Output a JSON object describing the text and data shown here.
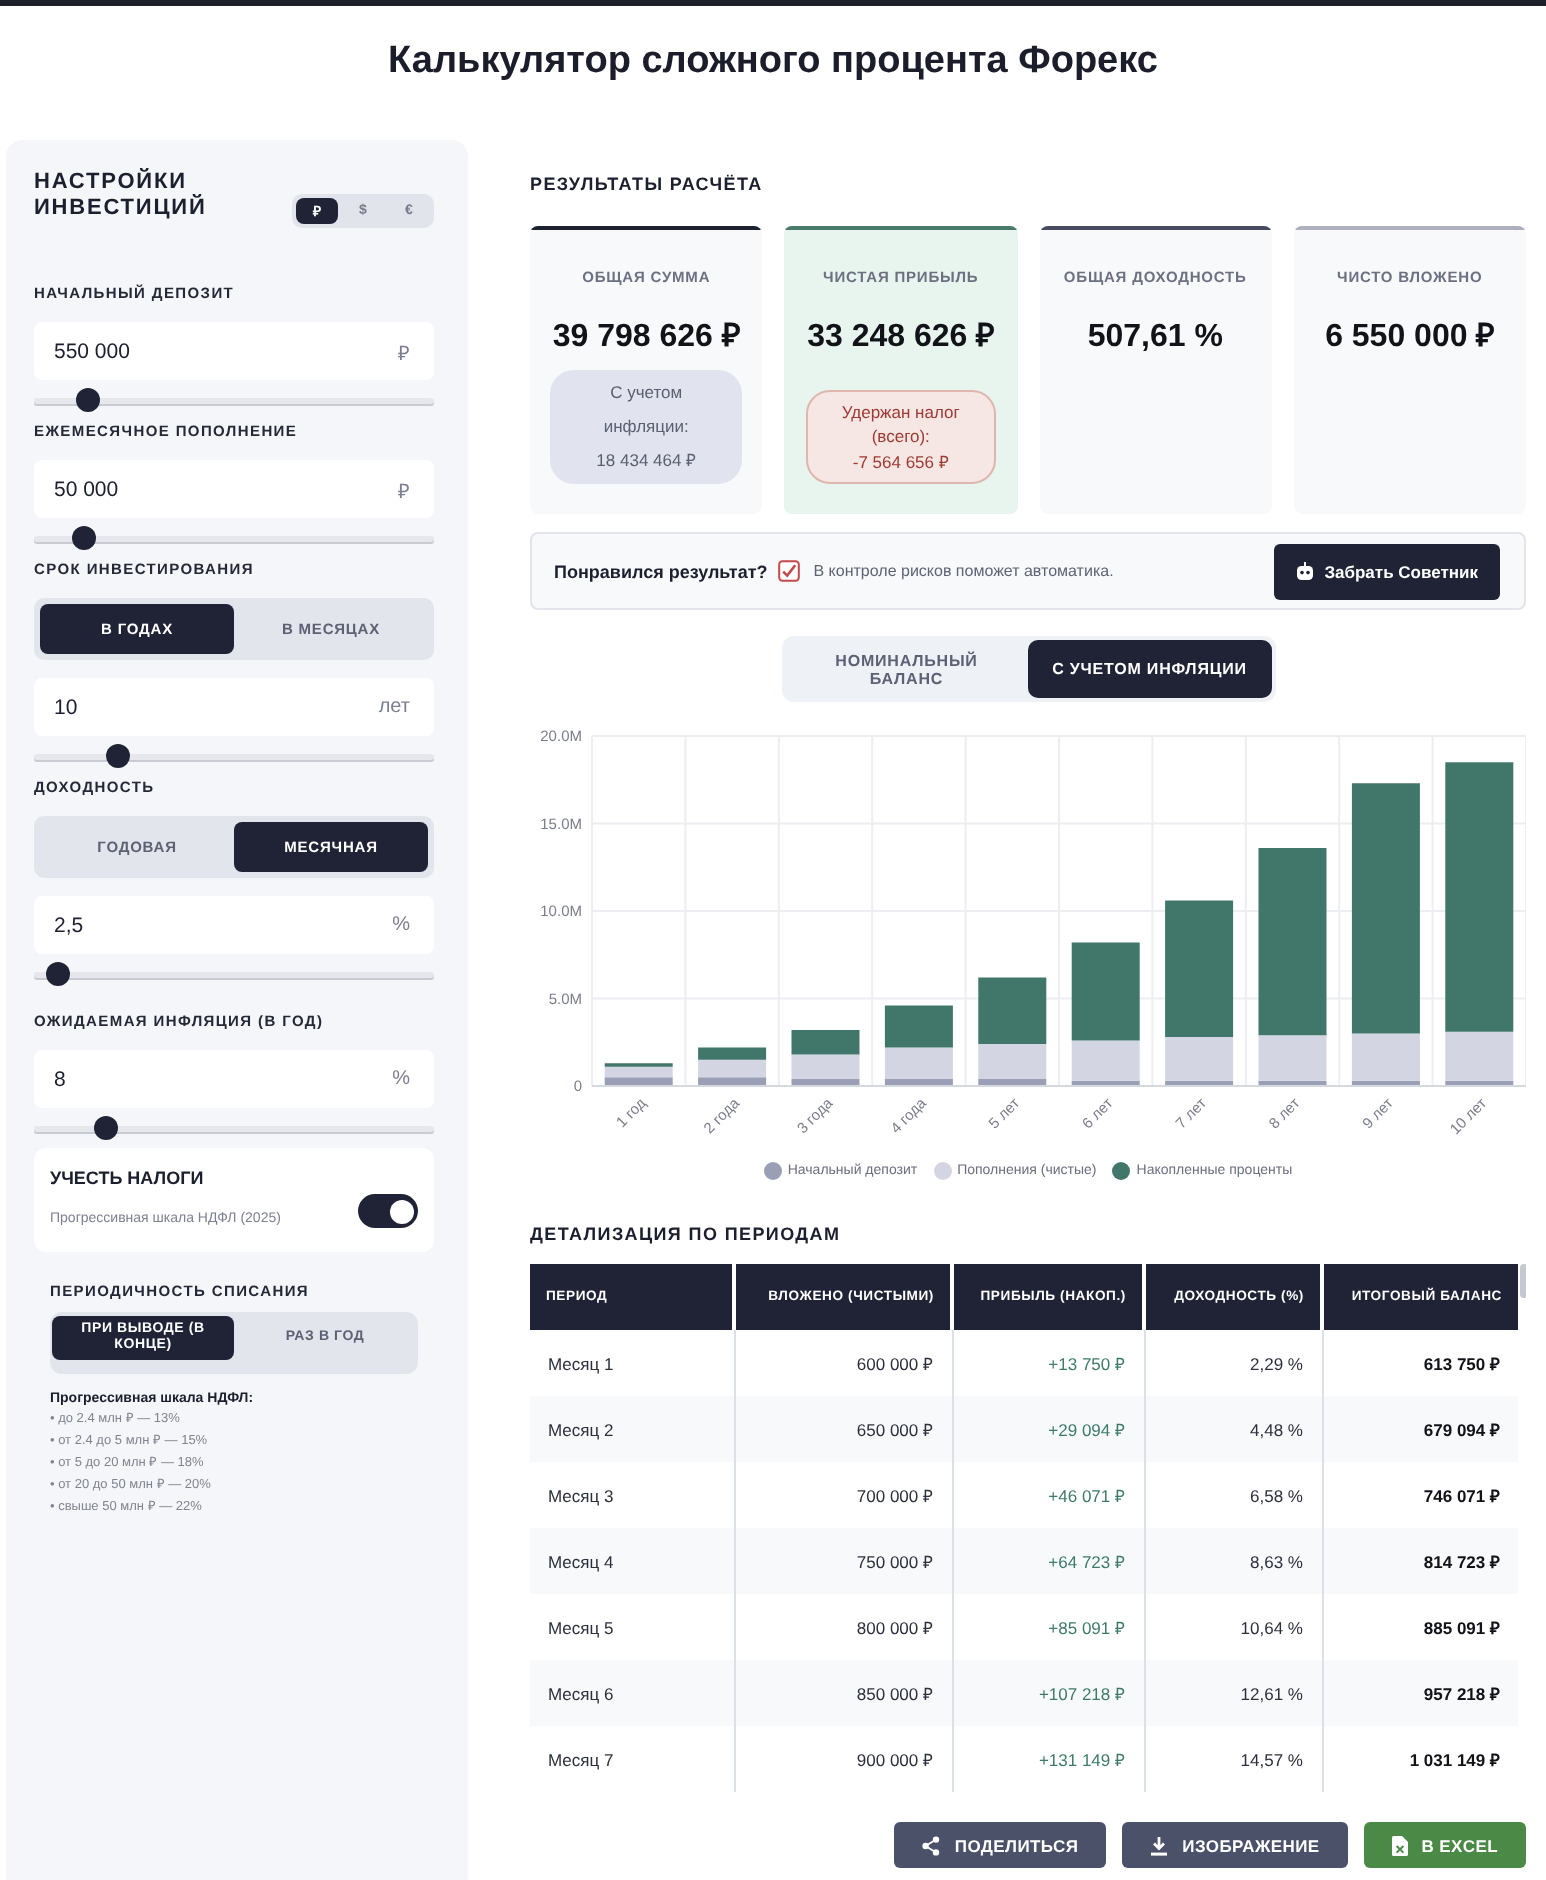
{
  "page_title": "Калькулятор сложного процента Форекс",
  "settings": {
    "heading": "НАСТРОЙКИ ИНВЕСТИЦИЙ",
    "currencies": [
      {
        "label": "₽",
        "selected": true
      },
      {
        "label": "$",
        "selected": false
      },
      {
        "label": "€",
        "selected": false
      }
    ],
    "fields": [
      {
        "label": "НАЧАЛЬНЫЙ ДЕПОЗИТ",
        "value": "550 000",
        "unit": "₽",
        "level": 0.11
      },
      {
        "label": "ЕЖЕМЕСЯЧНОЕ ПОПОЛНЕНИЕ",
        "value": "50 000",
        "unit": "₽",
        "level": 0.1
      },
      {
        "label": "СРОК ИНВЕСТИРОВАНИЯ",
        "options": [
          {
            "label": "В ГОДАХ",
            "selected": true
          },
          {
            "label": "В МЕСЯЦАХ",
            "selected": false
          }
        ],
        "value": "10",
        "unit": "лет",
        "level": 0.19
      },
      {
        "label": "ДОХОДНОСТЬ",
        "options": [
          {
            "label": "ГОДОВАЯ",
            "selected": false
          },
          {
            "label": "МЕСЯЧНАЯ",
            "selected": true
          }
        ],
        "value": "2,5",
        "unit": "%",
        "level": 0.03
      }
    ],
    "inflation": {
      "label": "ОЖИДАЕМАЯ ИНФЛЯЦИЯ (В ГОД)",
      "value": "8",
      "unit": "%",
      "level": 0.16
    },
    "tax": {
      "title": "УЧЕСТЬ НАЛОГИ",
      "subtitle": "Прогрессивная шкала НДФЛ (2025)",
      "on": true
    },
    "withdrawal": {
      "label": "ПЕРИОДИЧНОСТЬ СПИСАНИЯ",
      "options": [
        {
          "label": "ПРИ ВЫВОДЕ (В КОНЦЕ)",
          "selected": true
        },
        {
          "label": "РАЗ В ГОД",
          "selected": false
        }
      ]
    },
    "notes": {
      "title": "Прогрессивная шкала НДФЛ:",
      "items": [
        "• до 2.4 млн ₽ — 13%",
        "• от 2.4 до 5 млн ₽ — 15%",
        "• от 5 до 20 млн ₽ — 18%",
        "• от 20 до 50 млн ₽ — 20%",
        "• свыше 50 млн ₽ — 22%"
      ]
    }
  },
  "results": {
    "heading": "РЕЗУЛЬТАТЫ РАСЧЁТА",
    "cards": [
      {
        "label": "ОБЩАЯ СУММА",
        "value": "39 798 626 ₽",
        "color": "#1e2130",
        "highlighted": false,
        "note": {
          "kind": "info",
          "text": "С учетом инфляции:",
          "amount": "18 434 464 ₽"
        }
      },
      {
        "label": "ЧИСТАЯ ПРИБЫЛЬ",
        "value": "33 248 626 ₽",
        "color": "#4a7a6a",
        "highlighted": true,
        "note": {
          "kind": "warning",
          "text": "Удержан налог (всего):",
          "amount": "-7 564 656 ₽"
        }
      },
      {
        "label": "ОБЩАЯ ДОХОДНОСТЬ",
        "value": "507,61 %",
        "color": "#474b60",
        "highlighted": false
      },
      {
        "label": "ЧИСТО ВЛОЖЕНО",
        "value": "6 550 000 ₽",
        "color": "#aeb0be",
        "highlighted": false
      }
    ],
    "promo": {
      "question": "Понравился результат?",
      "text": "В контроле рисков поможет автоматика.",
      "button": "Забрать Советник"
    },
    "view_options": [
      {
        "label": "НОМИНАЛЬНЫЙ БАЛАНС",
        "selected": false
      },
      {
        "label": "С УЧЕТОМ ИНФЛЯЦИИ",
        "selected": true
      }
    ],
    "chart_data": {
      "type": "bar",
      "stacked": true,
      "grid": true,
      "legend": "bottom",
      "categories": [
        "1 год",
        "2 года",
        "3 года",
        "4 года",
        "5 лет",
        "6 лет",
        "7 лет",
        "8 лет",
        "9 лет",
        "10 лет"
      ],
      "series": [
        {
          "name": "Начальный депозит",
          "color": "#9b9fb5",
          "values": [
            0.5,
            0.5,
            0.4,
            0.4,
            0.4,
            0.3,
            0.3,
            0.3,
            0.3,
            0.3
          ]
        },
        {
          "name": "Пополнения (чистые)",
          "color": "#d3d6e2",
          "values": [
            0.6,
            1,
            1.4,
            1.8,
            2,
            2.3,
            2.5,
            2.6,
            2.7,
            2.8
          ]
        },
        {
          "name": "Накопленные проценты",
          "color": "#41776b",
          "values": [
            0.2,
            0.7,
            1.4,
            2.4,
            3.8,
            5.6,
            7.8,
            10.7,
            14.3,
            15.4
          ]
        }
      ],
      "ylim": [
        0,
        20
      ],
      "yticks": [
        {
          "value": 0,
          "label": "0"
        },
        {
          "value": 5,
          "label": "5.0M"
        },
        {
          "value": 10,
          "label": "10.0M"
        },
        {
          "value": 15,
          "label": "15.0M"
        },
        {
          "value": 20,
          "label": "20.0M"
        }
      ]
    }
  },
  "details": {
    "heading": "ДЕТАЛИЗАЦИЯ ПО ПЕРИОДАМ",
    "columns": [
      "ПЕРИОД",
      "ВЛОЖЕНО (ЧИСТЫМИ)",
      "ПРИБЫЛЬ (НАКОП.)",
      "ДОХОДНОСТЬ (%)",
      "ИТОГОВЫЙ БАЛАНС"
    ],
    "rows": [
      [
        "Месяц 1",
        "600 000 ₽",
        "+13 750 ₽",
        "2,29 %",
        "613 750 ₽"
      ],
      [
        "Месяц 2",
        "650 000 ₽",
        "+29 094 ₽",
        "4,48 %",
        "679 094 ₽"
      ],
      [
        "Месяц 3",
        "700 000 ₽",
        "+46 071 ₽",
        "6,58 %",
        "746 071 ₽"
      ],
      [
        "Месяц 4",
        "750 000 ₽",
        "+64 723 ₽",
        "8,63 %",
        "814 723 ₽"
      ],
      [
        "Месяц 5",
        "800 000 ₽",
        "+85 091 ₽",
        "10,64 %",
        "885 091 ₽"
      ],
      [
        "Месяц 6",
        "850 000 ₽",
        "+107 218 ₽",
        "12,61 %",
        "957 218 ₽"
      ],
      [
        "Месяц 7",
        "900 000 ₽",
        "+131 149 ₽",
        "14,57 %",
        "1 031 149 ₽"
      ]
    ]
  },
  "actions": [
    {
      "kind": "share",
      "label": "ПОДЕЛИТЬСЯ"
    },
    {
      "kind": "image",
      "label": "ИЗОБРАЖЕНИЕ"
    },
    {
      "kind": "excel",
      "label": "В EXCEL"
    }
  ]
}
